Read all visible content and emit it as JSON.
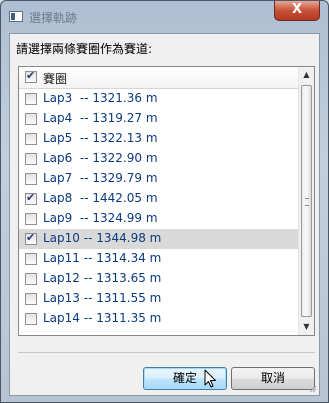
{
  "window": {
    "title": "選擇軌跡",
    "close_glyph": "X"
  },
  "prompt": "請選擇兩條賽圈作為賽道:",
  "list": {
    "header": {
      "label": "賽圈",
      "checked": true
    },
    "rows": [
      {
        "label": "Lap3  -- 1321.36 m",
        "checked": false,
        "selected": false
      },
      {
        "label": "Lap4  -- 1319.27 m",
        "checked": false,
        "selected": false
      },
      {
        "label": "Lap5  -- 1322.13 m",
        "checked": false,
        "selected": false
      },
      {
        "label": "Lap6  -- 1322.90 m",
        "checked": false,
        "selected": false
      },
      {
        "label": "Lap7  -- 1329.79 m",
        "checked": false,
        "selected": false
      },
      {
        "label": "Lap8  -- 1442.05 m",
        "checked": true,
        "selected": false
      },
      {
        "label": "Lap9  -- 1324.99 m",
        "checked": false,
        "selected": false
      },
      {
        "label": "Lap10 -- 1344.98 m",
        "checked": true,
        "selected": true
      },
      {
        "label": "Lap11 -- 1314.34 m",
        "checked": false,
        "selected": false
      },
      {
        "label": "Lap12 -- 1313.65 m",
        "checked": false,
        "selected": false
      },
      {
        "label": "Lap13 -- 1311.55 m",
        "checked": false,
        "selected": false
      },
      {
        "label": "Lap14 -- 1311.35 m",
        "checked": false,
        "selected": false
      }
    ]
  },
  "buttons": {
    "ok": "確定",
    "cancel": "取消"
  },
  "icons": {
    "app": "window-icon",
    "close": "close-icon",
    "scroll_up": "arrow-up-icon",
    "scroll_down": "arrow-down-icon",
    "cursor": "mouse-cursor-icon"
  },
  "colors": {
    "row_text": "#0b3a7e",
    "selected_row": "#d9d9d9",
    "close_button": "#c8513a",
    "primary_button": "#bee6fd"
  }
}
